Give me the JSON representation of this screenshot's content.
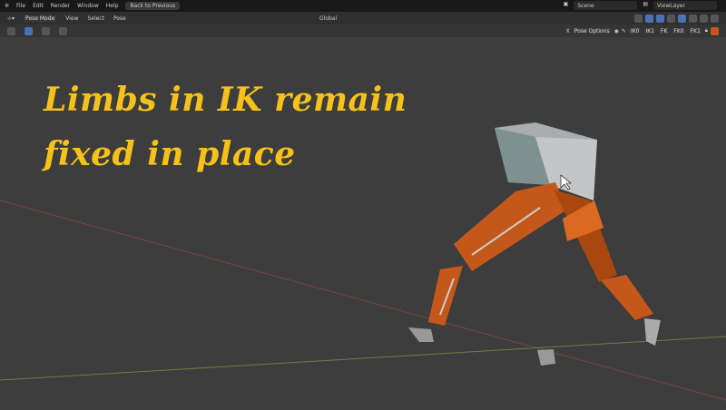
{
  "menu": {
    "items": [
      "File",
      "Edit",
      "Render",
      "Window",
      "Help"
    ],
    "back_button": "Back to Previous"
  },
  "scene": {
    "name": "Scene",
    "view_layer": "ViewLayer"
  },
  "header": {
    "mode": "Pose Mode",
    "menus": [
      "View",
      "Select",
      "Pose"
    ],
    "transform_orientation": "Global"
  },
  "toolbar2": {
    "pose_options": "Pose Options",
    "x_label": "X",
    "toggles": [
      "IK0",
      "IK1",
      "FK",
      "FK0",
      "FK1"
    ]
  },
  "caption": {
    "line1": "Limbs in IK remain",
    "line2": "fixed in place"
  },
  "colors": {
    "accent": "#4772b3",
    "caption": "#f6c21a",
    "limb": "#c4581a",
    "body": "#a9adae"
  }
}
